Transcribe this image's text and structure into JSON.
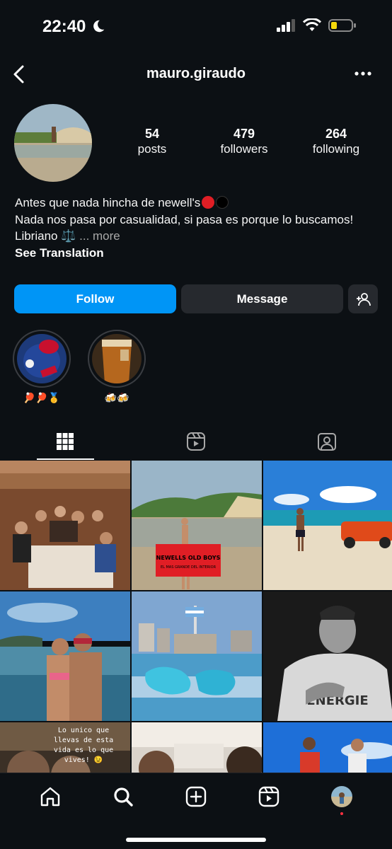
{
  "status_bar": {
    "time": "22:40"
  },
  "nav": {
    "username": "mauro.giraudo"
  },
  "stats": [
    {
      "num": "54",
      "label": "posts"
    },
    {
      "num": "479",
      "label": "followers"
    },
    {
      "num": "264",
      "label": "following"
    }
  ],
  "bio": {
    "line1": "Antes que nada hincha de newell's",
    "line2": "Nada nos pasa por casualidad, si pasa es porque lo buscamos!",
    "line3": "Libriano ⚖️",
    "more": "... more",
    "see_translation": "See Translation"
  },
  "buttons": {
    "follow": "Follow",
    "message": "Message"
  },
  "highlights": [
    {
      "label": "🏓🏓🥇"
    },
    {
      "label": "🍻🍻"
    }
  ],
  "grid_overlay_text": [
    "NEWELLS OLD BOYS",
    "EL MAS GRANDE DEL INTERIOR",
    "Lo unico que llevas de esta vida es lo que vives! 😉",
    "ENERGIE"
  ],
  "colors": {
    "background": "#0c1014",
    "accent": "#0095f6",
    "button": "#26292e",
    "newells_red": "#e01e25"
  }
}
